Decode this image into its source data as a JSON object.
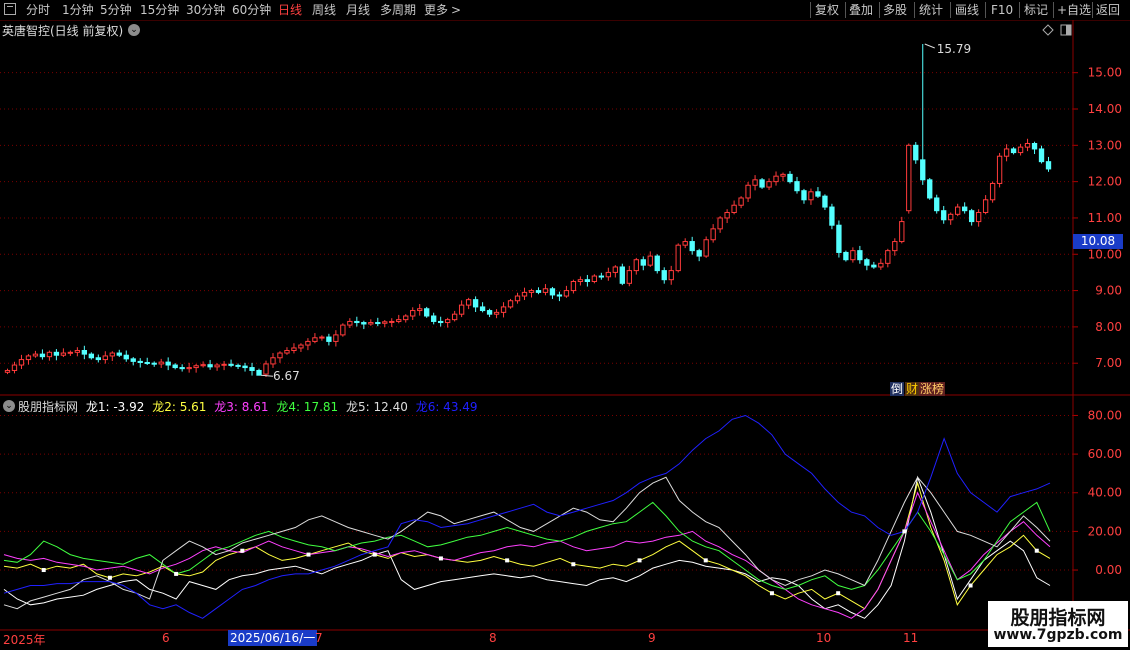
{
  "toolbar": {
    "periods": [
      "分时",
      "1分钟",
      "5分钟",
      "15分钟",
      "30分钟",
      "60分钟",
      "日线",
      "周线",
      "月线",
      "多周期",
      "更多"
    ],
    "active_period": "日线",
    "right_buttons": [
      "复权",
      "叠加",
      "多股",
      "统计",
      "画线",
      "F10",
      "标记",
      "+自选",
      "返回"
    ]
  },
  "main": {
    "title": "英唐智控(日线 前复权)",
    "current_price": "10.08",
    "high_label": "15.79",
    "low_label": "6.67",
    "badge_left": "倒",
    "badge_mid": "财",
    "badge_right": "涨榜"
  },
  "indicator": {
    "name": "股朋指标网",
    "lines": [
      {
        "label": "龙1: -3.92",
        "color": "#ffffff"
      },
      {
        "label": "龙2: 5.61",
        "color": "#ffff40"
      },
      {
        "label": "龙3: 8.61",
        "color": "#ff40ff"
      },
      {
        "label": "龙4: 17.81",
        "color": "#40ff40"
      },
      {
        "label": "龙5: 12.40",
        "color": "#dcdcdc"
      },
      {
        "label": "龙6: 43.49",
        "color": "#2020ff"
      }
    ]
  },
  "time_axis": {
    "labels": [
      "2025年",
      "6",
      "7",
      "8",
      "9",
      "10",
      "11"
    ],
    "cursor_label": "2025/06/16/一"
  },
  "watermark": {
    "text": "股朋指标网",
    "url": "www.7gpzb.com"
  },
  "chart_data": [
    {
      "type": "candlestick",
      "yaxis_ticks": [
        7.0,
        8.0,
        9.0,
        10.0,
        11.0,
        12.0,
        13.0,
        14.0,
        15.0
      ],
      "ylim": [
        6.4,
        15.9
      ],
      "close": [
        6.8,
        6.95,
        7.1,
        7.2,
        7.25,
        7.18,
        7.3,
        7.22,
        7.28,
        7.3,
        7.35,
        7.25,
        7.15,
        7.1,
        7.2,
        7.28,
        7.22,
        7.12,
        7.05,
        7.02,
        7.0,
        6.98,
        7.03,
        6.95,
        6.88,
        6.85,
        6.88,
        6.93,
        6.96,
        6.9,
        6.95,
        6.97,
        6.94,
        6.92,
        6.88,
        6.8,
        6.67,
        6.98,
        7.15,
        7.28,
        7.35,
        7.42,
        7.5,
        7.6,
        7.7,
        7.72,
        7.6,
        7.78,
        8.05,
        8.15,
        8.12,
        8.08,
        8.12,
        8.1,
        8.14,
        8.15,
        8.2,
        8.3,
        8.45,
        8.5,
        8.3,
        8.15,
        8.12,
        8.2,
        8.35,
        8.6,
        8.75,
        8.55,
        8.45,
        8.35,
        8.4,
        8.55,
        8.72,
        8.85,
        8.95,
        9.0,
        8.95,
        9.05,
        8.88,
        8.85,
        9.0,
        9.25,
        9.3,
        9.25,
        9.4,
        9.38,
        9.5,
        9.65,
        9.2,
        9.55,
        9.85,
        9.7,
        9.95,
        9.55,
        9.3,
        9.55,
        10.25,
        10.35,
        10.1,
        9.95,
        10.4,
        10.7,
        11.0,
        11.15,
        11.35,
        11.55,
        11.9,
        12.05,
        11.85,
        12.0,
        12.15,
        12.2,
        12.0,
        11.75,
        11.5,
        11.72,
        11.6,
        11.3,
        10.8,
        10.05,
        9.85,
        10.1,
        9.85,
        9.7,
        9.65,
        9.75,
        10.1,
        10.35,
        10.9,
        13.0,
        12.6,
        12.05,
        11.55,
        11.2,
        10.95,
        11.1,
        11.3,
        11.2,
        10.9,
        11.15,
        11.5,
        11.95,
        12.7,
        12.9,
        12.8,
        12.95,
        13.05,
        12.9,
        12.55,
        12.35
      ],
      "open": [
        6.75,
        6.8,
        6.95,
        7.1,
        7.2,
        7.25,
        7.18,
        7.3,
        7.22,
        7.28,
        7.3,
        7.35,
        7.25,
        7.15,
        7.1,
        7.2,
        7.28,
        7.22,
        7.12,
        7.05,
        7.02,
        7.0,
        6.98,
        7.03,
        6.95,
        6.88,
        6.85,
        6.88,
        6.93,
        6.96,
        6.9,
        6.95,
        6.97,
        6.94,
        6.92,
        6.88,
        6.8,
        6.7,
        6.98,
        7.15,
        7.28,
        7.35,
        7.42,
        7.5,
        7.6,
        7.7,
        7.72,
        7.6,
        7.78,
        8.05,
        8.15,
        8.12,
        8.08,
        8.12,
        8.1,
        8.14,
        8.15,
        8.2,
        8.3,
        8.45,
        8.5,
        8.3,
        8.15,
        8.12,
        8.2,
        8.35,
        8.6,
        8.75,
        8.55,
        8.45,
        8.35,
        8.4,
        8.55,
        8.72,
        8.85,
        8.95,
        9.0,
        8.95,
        9.05,
        8.88,
        8.85,
        9.0,
        9.25,
        9.3,
        9.25,
        9.4,
        9.38,
        9.5,
        9.65,
        9.2,
        9.55,
        9.85,
        9.7,
        9.95,
        9.55,
        9.3,
        9.55,
        10.25,
        10.35,
        10.1,
        9.95,
        10.4,
        10.7,
        11.0,
        11.15,
        11.35,
        11.55,
        11.9,
        12.05,
        11.85,
        12.0,
        12.15,
        12.2,
        12.0,
        11.75,
        11.5,
        11.72,
        11.6,
        11.3,
        10.8,
        10.05,
        9.85,
        10.1,
        9.85,
        9.7,
        9.65,
        9.75,
        10.1,
        10.35,
        11.2,
        13.0,
        12.6,
        12.05,
        11.55,
        11.2,
        10.95,
        11.1,
        11.3,
        11.2,
        10.9,
        11.15,
        11.5,
        11.95,
        12.7,
        12.9,
        12.8,
        12.95,
        13.05,
        12.9,
        12.55
      ],
      "high_point": 15.79,
      "low_point": 6.67
    },
    {
      "type": "line",
      "yaxis_ticks": [
        0.0,
        20.0,
        40.0,
        60.0,
        80.0
      ],
      "ylim": [
        -30,
        88
      ],
      "series": [
        {
          "name": "龙1",
          "color": "#ffffff",
          "values": [
            -10,
            -15,
            -18,
            -17,
            -15,
            -14,
            -13,
            -10,
            -8,
            -6,
            -5,
            -10,
            -12,
            -15,
            -6,
            -8,
            -10,
            -5,
            -3,
            -2,
            0,
            1,
            2,
            0,
            -2,
            1,
            3,
            5,
            8,
            10,
            -5,
            -10,
            -8,
            -6,
            -5,
            -4,
            -3,
            -2,
            -3,
            -4,
            -3,
            -5,
            -6,
            -7,
            -8,
            -5,
            -4,
            -6,
            -3,
            1,
            3,
            5,
            4,
            2,
            1,
            0,
            -2,
            -6,
            -4,
            -5,
            -8,
            -15,
            -20,
            -18,
            -22,
            -25,
            -18,
            -8,
            15,
            48,
            30,
            8,
            -15,
            -5,
            5,
            10,
            15,
            10,
            -4,
            -8
          ]
        },
        {
          "name": "龙2",
          "color": "#ffff40",
          "values": [
            2,
            1,
            3,
            0,
            2,
            1,
            3,
            -2,
            -4,
            -2,
            -3,
            -1,
            2,
            -2,
            -3,
            -1,
            5,
            8,
            10,
            12,
            8,
            5,
            6,
            8,
            10,
            12,
            14,
            10,
            8,
            6,
            9,
            7,
            8,
            6,
            5,
            4,
            5,
            7,
            5,
            3,
            2,
            4,
            6,
            3,
            2,
            1,
            3,
            2,
            5,
            8,
            12,
            15,
            10,
            5,
            3,
            0,
            -3,
            -8,
            -12,
            -15,
            -12,
            -10,
            -15,
            -12,
            -16,
            -20,
            -10,
            5,
            20,
            45,
            22,
            5,
            -18,
            -8,
            0,
            8,
            12,
            18,
            10,
            6
          ]
        },
        {
          "name": "龙3",
          "color": "#ff40ff",
          "values": [
            8,
            6,
            5,
            6,
            4,
            3,
            2,
            0,
            1,
            2,
            0,
            -2,
            1,
            3,
            6,
            10,
            12,
            10,
            9,
            12,
            15,
            12,
            10,
            8,
            9,
            10,
            12,
            11,
            9,
            7,
            9,
            10,
            8,
            6,
            5,
            7,
            9,
            10,
            12,
            13,
            12,
            14,
            15,
            12,
            10,
            11,
            12,
            15,
            14,
            15,
            17,
            18,
            20,
            15,
            12,
            8,
            5,
            0,
            -5,
            -10,
            -15,
            -18,
            -20,
            -22,
            -25,
            -20,
            -10,
            5,
            20,
            40,
            25,
            10,
            -5,
            0,
            8,
            14,
            20,
            25,
            18,
            12
          ]
        },
        {
          "name": "龙4",
          "color": "#40ff40",
          "values": [
            5,
            4,
            8,
            15,
            12,
            8,
            6,
            5,
            4,
            3,
            6,
            8,
            3,
            -2,
            0,
            5,
            10,
            12,
            15,
            18,
            20,
            17,
            15,
            13,
            12,
            10,
            12,
            14,
            15,
            17,
            18,
            15,
            12,
            13,
            15,
            17,
            18,
            20,
            22,
            20,
            18,
            16,
            15,
            17,
            20,
            22,
            24,
            25,
            30,
            35,
            28,
            20,
            15,
            12,
            10,
            5,
            0,
            -5,
            -8,
            -10,
            -8,
            -5,
            -3,
            -8,
            -10,
            -8,
            0,
            10,
            20,
            30,
            20,
            8,
            -5,
            -2,
            5,
            15,
            25,
            30,
            35,
            20
          ]
        },
        {
          "name": "龙5",
          "color": "#dcdcdc",
          "values": [
            -18,
            -20,
            -16,
            -14,
            -12,
            -10,
            -5,
            -3,
            -6,
            -10,
            -12,
            -15,
            5,
            10,
            15,
            12,
            8,
            10,
            14,
            16,
            18,
            20,
            22,
            26,
            28,
            25,
            22,
            20,
            18,
            16,
            20,
            25,
            30,
            28,
            24,
            26,
            28,
            30,
            26,
            22,
            20,
            24,
            28,
            32,
            30,
            26,
            25,
            32,
            40,
            45,
            48,
            36,
            30,
            25,
            22,
            15,
            8,
            0,
            -5,
            -8,
            -5,
            -3,
            0,
            -2,
            -5,
            -8,
            5,
            20,
            35,
            48,
            40,
            30,
            20,
            18,
            15,
            12,
            20,
            28,
            22,
            15
          ]
        },
        {
          "name": "龙6",
          "color": "#2020ff",
          "values": [
            -12,
            -10,
            -8,
            -8,
            -7,
            -7,
            -6,
            -6,
            -6,
            -8,
            -12,
            -18,
            -20,
            -18,
            -22,
            -25,
            -20,
            -15,
            -10,
            -8,
            -5,
            -3,
            -2,
            -2,
            0,
            2,
            5,
            8,
            10,
            12,
            24,
            26,
            25,
            22,
            23,
            24,
            26,
            28,
            30,
            32,
            34,
            30,
            28,
            30,
            32,
            34,
            36,
            40,
            45,
            48,
            50,
            55,
            62,
            68,
            72,
            78,
            80,
            76,
            70,
            60,
            55,
            50,
            42,
            35,
            30,
            28,
            22,
            18,
            20,
            30,
            48,
            68,
            50,
            40,
            35,
            30,
            38,
            40,
            42,
            45
          ]
        }
      ]
    }
  ]
}
